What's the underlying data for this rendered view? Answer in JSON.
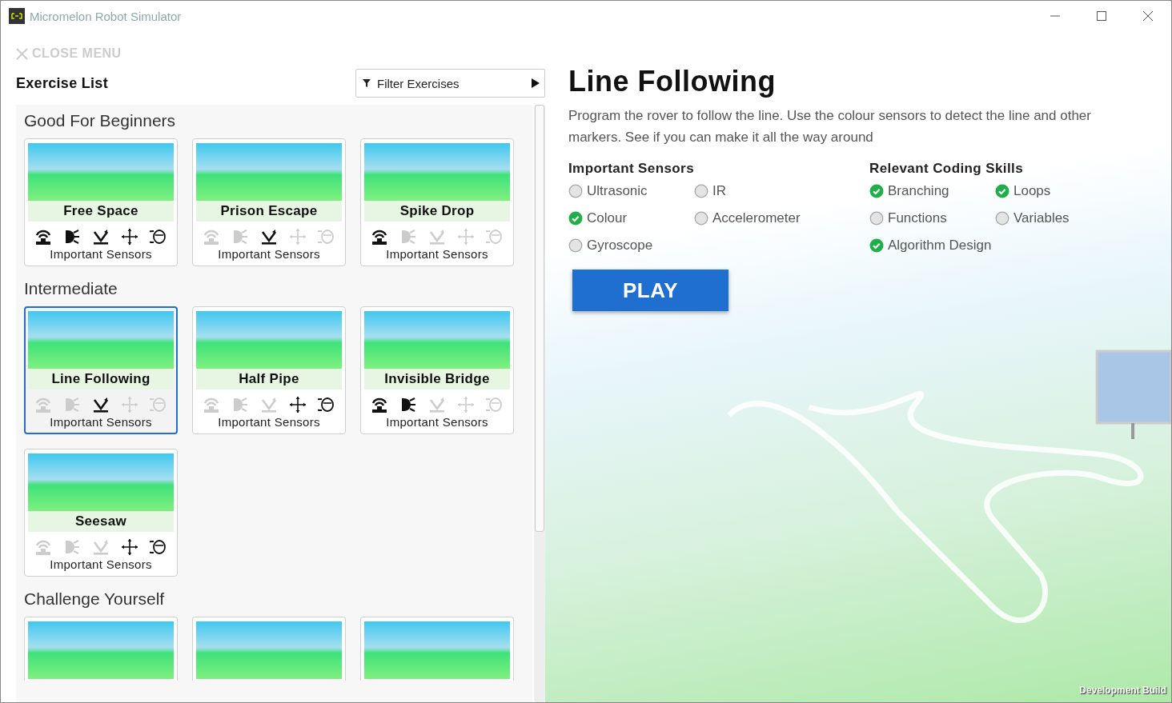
{
  "window": {
    "title": "Micromelon Robot Simulator"
  },
  "menu": {
    "close_label": "CLOSE MENU",
    "heading": "Exercise List",
    "filter": {
      "placeholder": "Filter Exercises"
    }
  },
  "sections": [
    {
      "title": "Good For Beginners",
      "cards": [
        {
          "title": "Free Space",
          "selected": false,
          "caption": "Important Sensors",
          "sensors": [
            {
              "kind": "ultrasonic",
              "active": true
            },
            {
              "kind": "ir",
              "active": true
            },
            {
              "kind": "colour",
              "active": true
            },
            {
              "kind": "accelerometer",
              "active": true
            },
            {
              "kind": "gyroscope",
              "active": true
            }
          ]
        },
        {
          "title": "Prison Escape",
          "selected": false,
          "caption": "Important Sensors",
          "sensors": [
            {
              "kind": "ultrasonic",
              "active": false
            },
            {
              "kind": "ir",
              "active": false
            },
            {
              "kind": "colour",
              "active": true
            },
            {
              "kind": "accelerometer",
              "active": false
            },
            {
              "kind": "gyroscope",
              "active": false
            }
          ]
        },
        {
          "title": "Spike Drop",
          "selected": false,
          "caption": "Important Sensors",
          "sensors": [
            {
              "kind": "ultrasonic",
              "active": true
            },
            {
              "kind": "ir",
              "active": false
            },
            {
              "kind": "colour",
              "active": false
            },
            {
              "kind": "accelerometer",
              "active": false
            },
            {
              "kind": "gyroscope",
              "active": false
            }
          ]
        }
      ]
    },
    {
      "title": "Intermediate",
      "cards": [
        {
          "title": "Line Following",
          "selected": true,
          "caption": "Important Sensors",
          "sensors": [
            {
              "kind": "ultrasonic",
              "active": false
            },
            {
              "kind": "ir",
              "active": false
            },
            {
              "kind": "colour",
              "active": true
            },
            {
              "kind": "accelerometer",
              "active": false
            },
            {
              "kind": "gyroscope",
              "active": false
            }
          ]
        },
        {
          "title": "Half Pipe",
          "selected": false,
          "caption": "Important Sensors",
          "sensors": [
            {
              "kind": "ultrasonic",
              "active": false
            },
            {
              "kind": "ir",
              "active": false
            },
            {
              "kind": "colour",
              "active": false
            },
            {
              "kind": "accelerometer",
              "active": true
            },
            {
              "kind": "gyroscope",
              "active": true
            }
          ]
        },
        {
          "title": "Invisible Bridge",
          "selected": false,
          "caption": "Important Sensors",
          "sensors": [
            {
              "kind": "ultrasonic",
              "active": true
            },
            {
              "kind": "ir",
              "active": true
            },
            {
              "kind": "colour",
              "active": false
            },
            {
              "kind": "accelerometer",
              "active": false
            },
            {
              "kind": "gyroscope",
              "active": false
            }
          ]
        },
        {
          "title": "Seesaw",
          "selected": false,
          "caption": "Important Sensors",
          "sensors": [
            {
              "kind": "ultrasonic",
              "active": false
            },
            {
              "kind": "ir",
              "active": false
            },
            {
              "kind": "colour",
              "active": false
            },
            {
              "kind": "accelerometer",
              "active": true
            },
            {
              "kind": "gyroscope",
              "active": true
            }
          ]
        }
      ]
    },
    {
      "title": "Challenge Yourself",
      "cards": [
        {
          "selected": false
        },
        {
          "selected": false
        },
        {
          "selected": false
        }
      ]
    }
  ],
  "detail": {
    "title": "Line Following",
    "description": "Program the rover to follow the line. Use the colour sensors to detect the line and other markers. See if you can make it all the way around",
    "sensors_heading": "Important Sensors",
    "sensors": [
      {
        "label": "Ultrasonic",
        "checked": false
      },
      {
        "label": "IR",
        "checked": false
      },
      {
        "label": "Colour",
        "checked": true
      },
      {
        "label": "Accelerometer",
        "checked": false
      },
      {
        "label": "Gyroscope",
        "checked": false
      }
    ],
    "skills_heading": "Relevant Coding Skills",
    "skills": [
      {
        "label": "Branching",
        "checked": true
      },
      {
        "label": "Loops",
        "checked": true
      },
      {
        "label": "Functions",
        "checked": false
      },
      {
        "label": "Variables",
        "checked": false
      },
      {
        "label": "Algorithm Design",
        "checked": true
      }
    ],
    "play_label": "PLAY"
  },
  "build_label": "Development Build"
}
